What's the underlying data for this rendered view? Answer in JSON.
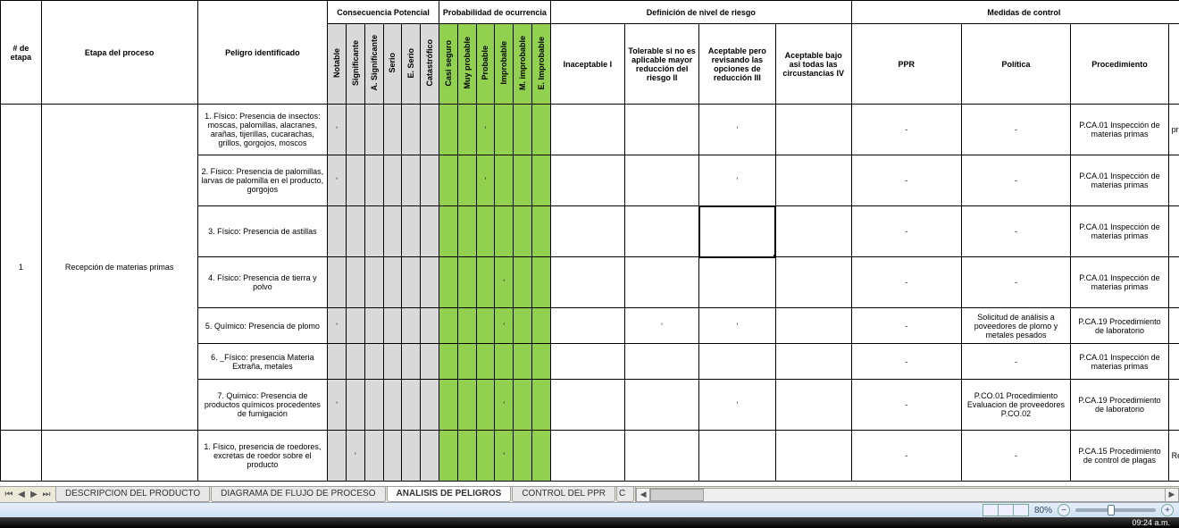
{
  "headers": {
    "etapa_num": "# de etapa",
    "etapa_proc": "Etapa del proceso",
    "peligro": "Peligro identificado",
    "consecuencia": "Consecuencia Potencial",
    "probabilidad": "Probabilidad de ocurrencia",
    "nivel_riesgo": "Definición de nivel de riesgo",
    "medidas": "Medidas de control",
    "cons_cols": [
      "Notable",
      "Significante",
      "A. Significante",
      "Serio",
      "E. Serio",
      "Catastrófico"
    ],
    "prob_cols": [
      "Casi seguro",
      "Muy probable",
      "Probable",
      "Improbable",
      "M. improbable",
      "E. Improbable"
    ],
    "riesgo_cols": {
      "inaceptable": "Inaceptable I",
      "tolerable": "Tolerable si no es aplicable mayor reducción del riesgo II",
      "aceptable3": "Aceptable pero revisando las opciones de reducción III",
      "aceptable4": "Aceptable bajo asi todas las circustancias IV"
    },
    "medidas_cols": {
      "ppr": "PPR",
      "politica": "Política",
      "proced": "Procedimiento"
    }
  },
  "stage_num": "1",
  "stage_name": "Recepción de materias primas",
  "rows": [
    {
      "peligro": "1. Físico: Presencia de insectos: moscas, palomillas, alacranes, arañas, tijerillas, cucarachas, grillos, gorgojos, moscos",
      "cons_idx": 0,
      "prob_idx": 2,
      "risk_idx": 2,
      "ppr": "-",
      "politica": "-",
      "proced": "P.CA.01 Inspección de materias primas",
      "extra": "pro"
    },
    {
      "peligro": "2. Físico: Presencia de palomillas, larvas de palomilla en el producto, gorgojos",
      "cons_idx": 0,
      "prob_idx": 2,
      "risk_idx": 2,
      "ppr": "-",
      "politica": "-",
      "proced": "P.CA.01 Inspección de materias primas",
      "extra": ""
    },
    {
      "peligro": "3. Físico: Presencia de astillas",
      "cons_idx": -1,
      "prob_idx": -1,
      "risk_idx": -1,
      "selected_risk": 2,
      "ppr": "-",
      "politica": "-",
      "proced": "P.CA.01 Inspección de materias primas",
      "extra": ""
    },
    {
      "peligro": "4. Físico: Presencia de tierra y polvo",
      "cons_idx": -1,
      "prob_idx": 3,
      "risk_idx": -1,
      "ppr": "-",
      "politica": "-",
      "proced": "P.CA.01 Inspección de materias primas",
      "extra": ""
    },
    {
      "peligro": "5. Químico: Presencia de plomo",
      "cons_idx": 0,
      "prob_idx": 3,
      "risk_idx": 2,
      "risk_idx2": 1,
      "ppr": "-",
      "politica": "Solicitud de análisis a poveedores de plomo y metales pesados",
      "proced": "P.CA.19 Procedimiento de laboratorio",
      "extra": ""
    },
    {
      "peligro": "6. _Físico: presencia Materia Extraña, metales",
      "cons_idx": -1,
      "prob_idx": -1,
      "risk_idx": -1,
      "ppr": "-",
      "politica": "-",
      "proced": "P.CA.01 Inspección de materias primas",
      "extra": ""
    },
    {
      "peligro": "7. Químico: Presencia de productos químicos procedentes de fumigación",
      "cons_idx": 0,
      "prob_idx": 3,
      "risk_idx": 2,
      "ppr": "-",
      "politica": "P.CO.01 Procedimiento Evaluacion de proveedores P.CO.02",
      "proced": "P.CA.19 Procedimiento de laboratorio",
      "extra": ""
    },
    {
      "peligro": "1. Físico, presencia de roedores, excretas de roedor sobre el producto",
      "cons_idx": 1,
      "prob_idx": 3,
      "risk_idx": -1,
      "ppr": "-",
      "politica": "-",
      "proced": "P.CA.15 Procedimiento de control de plagas",
      "extra": "Re"
    }
  ],
  "tabs": {
    "items": [
      "DESCRIPCION DEL PRODUCTO",
      "DIAGRAMA DE FLUJO DE PROCESO",
      "ANALISIS DE PELIGROS",
      "CONTROL DEL PPR"
    ],
    "active": 2,
    "partial": "C"
  },
  "status": {
    "zoom": "80%",
    "clock": "09:24 a.m."
  }
}
